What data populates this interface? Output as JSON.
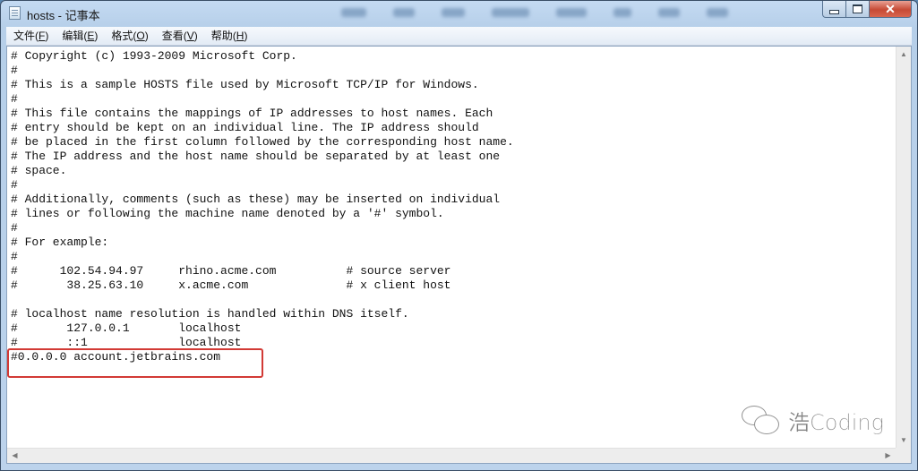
{
  "window": {
    "title": "hosts - 记事本",
    "controls": {
      "minimize": "—",
      "maximize": "□",
      "close": "✕"
    }
  },
  "menubar": {
    "items": [
      {
        "label": "文件",
        "accel": "F"
      },
      {
        "label": "编辑",
        "accel": "E"
      },
      {
        "label": "格式",
        "accel": "O"
      },
      {
        "label": "查看",
        "accel": "V"
      },
      {
        "label": "帮助",
        "accel": "H"
      }
    ]
  },
  "editor": {
    "lines": [
      "# Copyright (c) 1993-2009 Microsoft Corp.",
      "#",
      "# This is a sample HOSTS file used by Microsoft TCP/IP for Windows.",
      "#",
      "# This file contains the mappings of IP addresses to host names. Each",
      "# entry should be kept on an individual line. The IP address should",
      "# be placed in the first column followed by the corresponding host name.",
      "# The IP address and the host name should be separated by at least one",
      "# space.",
      "#",
      "# Additionally, comments (such as these) may be inserted on individual",
      "# lines or following the machine name denoted by a '#' symbol.",
      "#",
      "# For example:",
      "#",
      "#      102.54.94.97     rhino.acme.com          # source server",
      "#       38.25.63.10     x.acme.com              # x client host",
      "",
      "# localhost name resolution is handled within DNS itself.",
      "#       127.0.0.1       localhost",
      "#       ::1             localhost",
      "#0.0.0.0 account.jetbrains.com"
    ],
    "highlighted_line": "#0.0.0.0 account.jetbrains.com",
    "highlight_color": "#d23a35"
  },
  "scrollbars": {
    "up_arrow": "▲",
    "down_arrow": "▼",
    "left_arrow": "◀",
    "right_arrow": "▶"
  },
  "watermark": {
    "icon": "wechat-icon",
    "text": "浩Coding"
  }
}
